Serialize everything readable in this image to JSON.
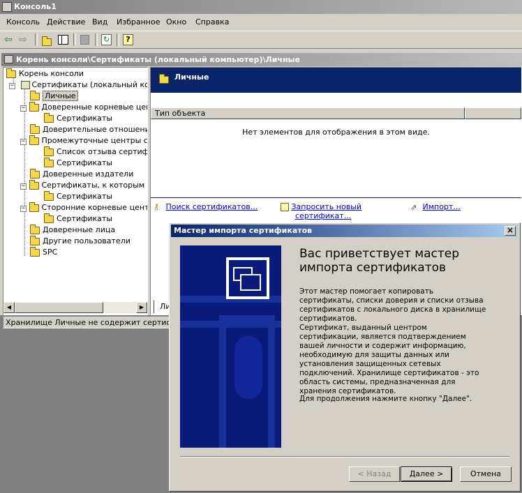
{
  "window": {
    "title": "Консоль1"
  },
  "menu": [
    "Консоль",
    "Действие",
    "Вид",
    "Избранное",
    "Окно",
    "Справка"
  ],
  "address": {
    "path": "Корень консоли\\Сертификаты (локальный компьютер)\\Личные"
  },
  "tree": {
    "items": [
      {
        "label": "Корень консоли"
      },
      {
        "label": "Сертификаты (локальный комп"
      },
      {
        "label": "Личные"
      },
      {
        "label": "Доверенные корневые цент"
      },
      {
        "label": "Сертификаты"
      },
      {
        "label": "Доверительные отношения"
      },
      {
        "label": "Промежуточные центры сер"
      },
      {
        "label": "Список отзыва сертифи"
      },
      {
        "label": "Сертификаты"
      },
      {
        "label": "Доверенные издатели"
      },
      {
        "label": "Сертификаты, к которым не"
      },
      {
        "label": "Сертификаты"
      },
      {
        "label": "Сторонние корневые центр"
      },
      {
        "label": "Сертификаты"
      },
      {
        "label": "Доверенные лица"
      },
      {
        "label": "Другие пользователи"
      },
      {
        "label": "SPC"
      }
    ]
  },
  "pane": {
    "header": "Личные",
    "column": "Тип объекта",
    "empty": "Нет элементов для отображения в этом виде.",
    "tasks": {
      "find": "Поиск сертификатов...",
      "request_line1": "Запросить новый",
      "request_line2": "сертификат...",
      "import": "Импорт..."
    },
    "tab": "Личн"
  },
  "status": {
    "text": "Хранилище Личные не содержит сертификатов"
  },
  "wizard": {
    "title": "Мастер импорта сертификатов",
    "heading_line1": "Вас приветствует мастер",
    "heading_line2": "импорта сертификатов",
    "para1": "Этот мастер помогает копировать сертификаты, списки доверия и списки отзыва сертификатов с локального диска в хранилище сертификатов.",
    "para2": "Сертификат, выданный центром сертификации, является подтверждением вашей личности и содержит информацию, необходимую для защиты данных или установления защищенных сетевых подключений. Хранилище сертификатов - это область системы, предназначенная для хранения сертификатов.",
    "para3": "Для продолжения нажмите кнопку \"Далее\".",
    "back": "< Назад",
    "next": "Далее >",
    "cancel": "Отмена",
    "close": "×"
  }
}
